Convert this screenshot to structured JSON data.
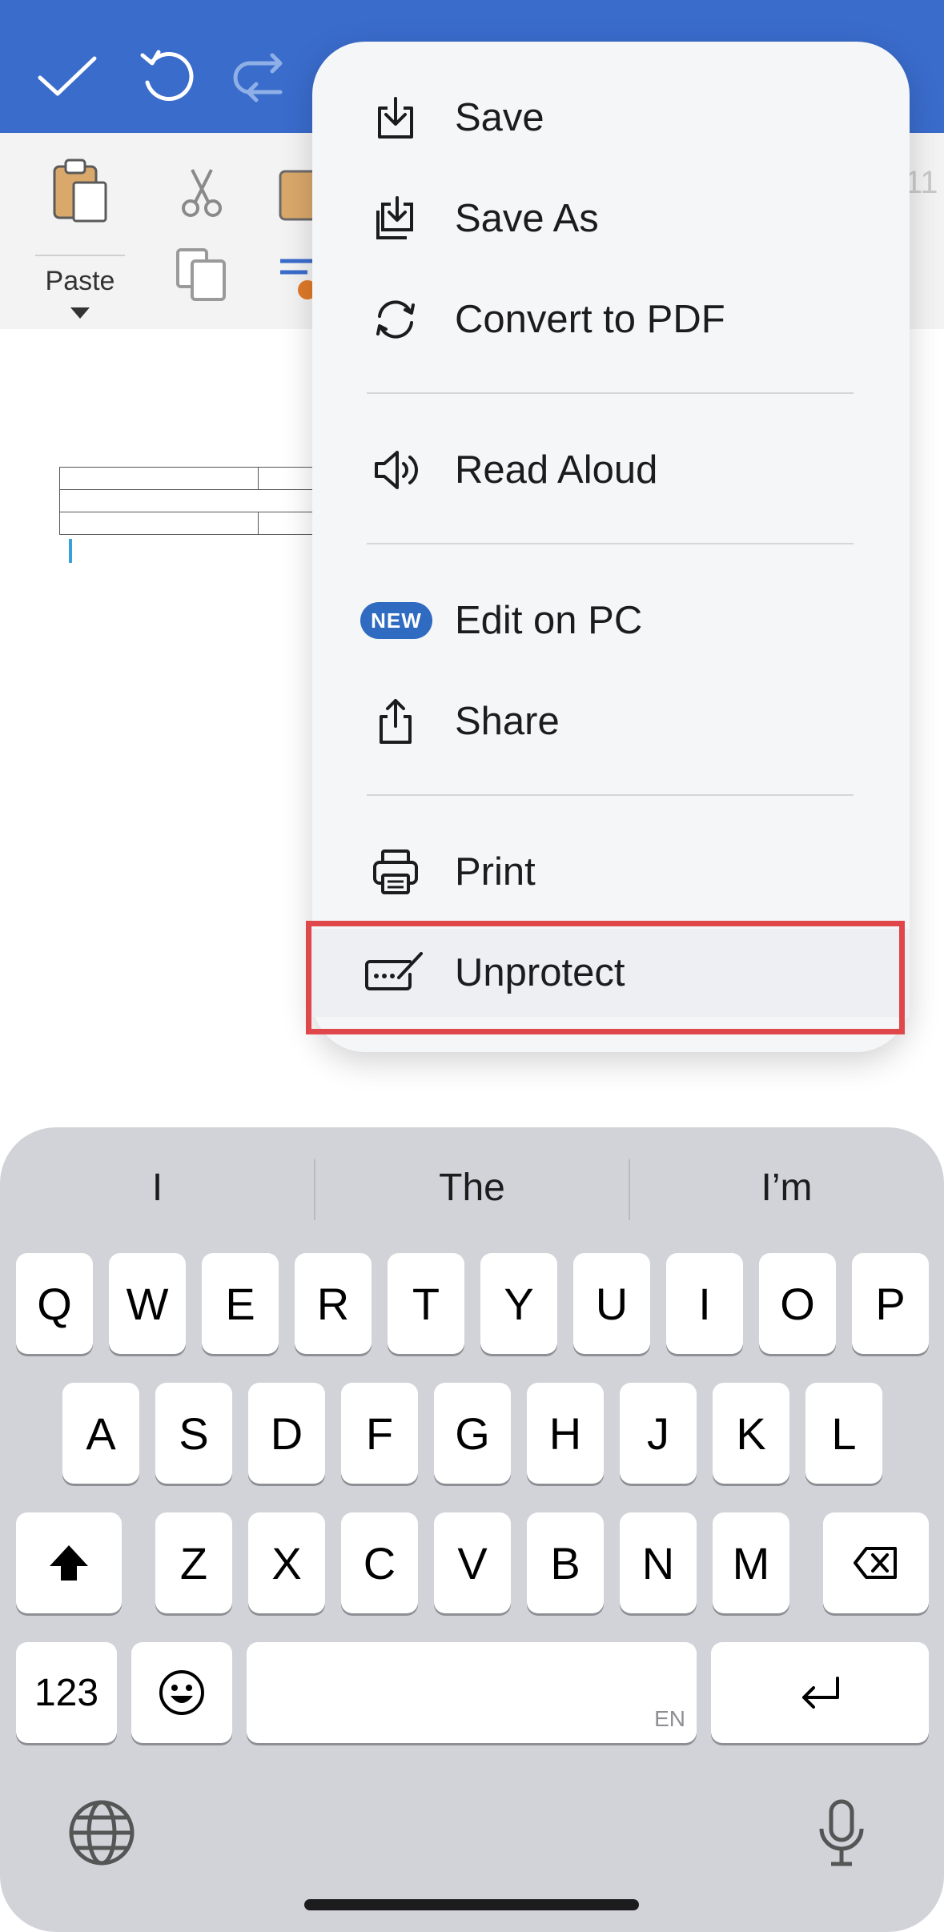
{
  "toolbar": {
    "icons": [
      "checkmark-icon",
      "undo-icon",
      "redo-icon"
    ]
  },
  "ribbon": {
    "paste_label": "Paste",
    "font_size_hint": "11"
  },
  "menu": {
    "items": [
      {
        "label": "Save",
        "icon": "save-icon"
      },
      {
        "label": "Save As",
        "icon": "save-as-icon"
      },
      {
        "label": "Convert to PDF",
        "icon": "convert-icon"
      },
      {
        "label": "Read Aloud",
        "icon": "speaker-icon"
      },
      {
        "label": "Edit on PC",
        "icon": "new-badge",
        "badge": "NEW"
      },
      {
        "label": "Share",
        "icon": "share-icon"
      },
      {
        "label": "Print",
        "icon": "printer-icon"
      },
      {
        "label": "Unprotect",
        "icon": "signature-icon"
      }
    ],
    "highlight_color": "#e0474b"
  },
  "keyboard": {
    "predictions": [
      "I",
      "The",
      "I’m"
    ],
    "row1": [
      "Q",
      "W",
      "E",
      "R",
      "T",
      "Y",
      "U",
      "I",
      "O",
      "P"
    ],
    "row2": [
      "A",
      "S",
      "D",
      "F",
      "G",
      "H",
      "J",
      "K",
      "L"
    ],
    "row3": [
      "Z",
      "X",
      "C",
      "V",
      "B",
      "N",
      "M"
    ],
    "numbers_label": "123",
    "space_hint": "EN"
  },
  "colors": {
    "toolbar_blue": "#3a6ccc",
    "badge_blue": "#2f6bc1"
  }
}
